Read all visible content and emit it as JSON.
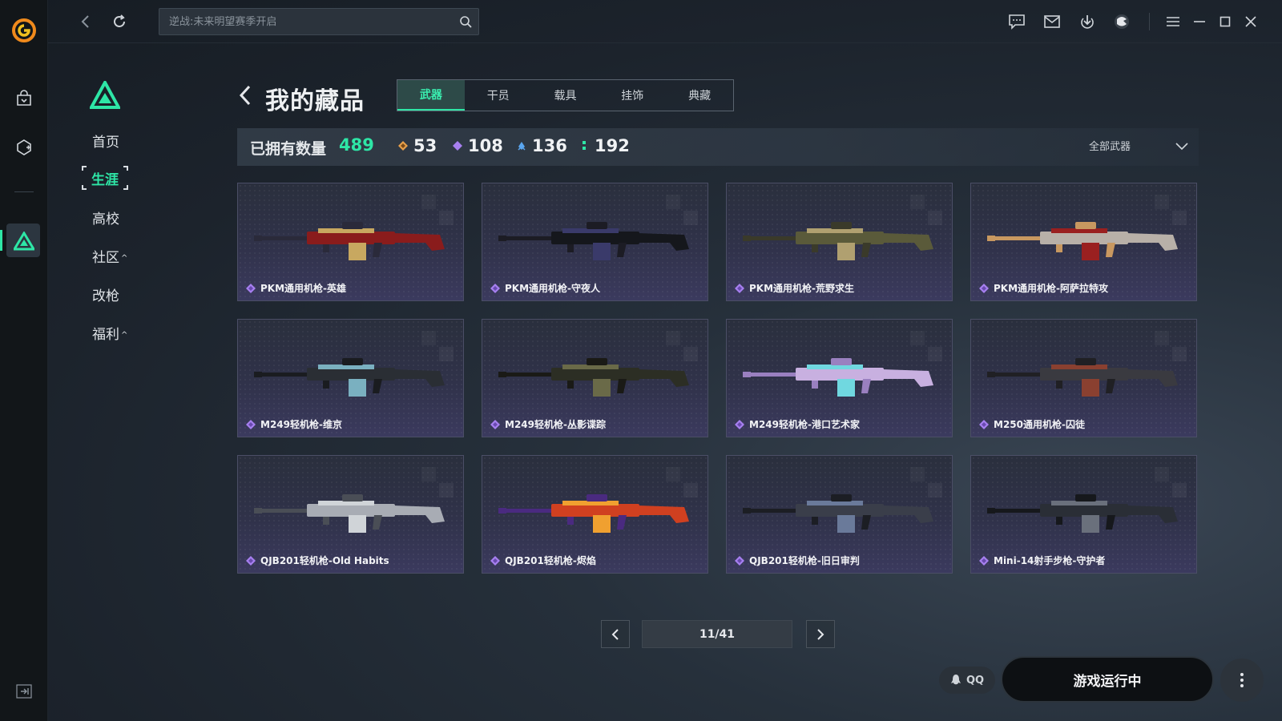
{
  "topbar": {
    "search_placeholder": "逆战:未来明望赛季开启"
  },
  "sidebar": {
    "items": [
      {
        "label": "首页"
      },
      {
        "label": "生涯"
      },
      {
        "label": "高校"
      },
      {
        "label": "社区",
        "caret": "^"
      },
      {
        "label": "改枪"
      },
      {
        "label": "福利",
        "caret": "^"
      }
    ]
  },
  "header": {
    "title": "我的藏品",
    "tabs": [
      {
        "label": "武器"
      },
      {
        "label": "干员"
      },
      {
        "label": "载具"
      },
      {
        "label": "挂饰"
      },
      {
        "label": "典藏"
      }
    ]
  },
  "stats": {
    "owned_label": "已拥有数量",
    "owned_total": "489",
    "tiers": [
      {
        "count": "53",
        "color": "#e8a04a"
      },
      {
        "count": "108",
        "color": "#a780f0"
      },
      {
        "count": "136",
        "color": "#5aa6f0"
      },
      {
        "count": "192",
        "color": "#2ee6a6"
      }
    ],
    "filter_label": "全部武器"
  },
  "cards": [
    {
      "name": "PKM通用机枪-英雄",
      "palette": [
        "#8a1c1c",
        "#c8a860",
        "#2a2a3a"
      ]
    },
    {
      "name": "PKM通用机枪-守夜人",
      "palette": [
        "#15171c",
        "#3a3a6a",
        "#1c1c24"
      ]
    },
    {
      "name": "PKM通用机枪-荒野求生",
      "palette": [
        "#5a5a3a",
        "#b0a070",
        "#3a3a2a"
      ]
    },
    {
      "name": "PKM通用机枪-阿萨拉特攻",
      "palette": [
        "#b8b0a8",
        "#9a2020",
        "#c89860"
      ]
    },
    {
      "name": "M249轻机枪-维京",
      "palette": [
        "#2a2e34",
        "#7ab0c0",
        "#1a1c20"
      ]
    },
    {
      "name": "M249轻机枪-丛影谍踪",
      "palette": [
        "#2c2e24",
        "#6a6a48",
        "#1a1a16"
      ]
    },
    {
      "name": "M249轻机枪-港口艺术家",
      "palette": [
        "#c8b0e0",
        "#70d8e0",
        "#9a80c0"
      ]
    },
    {
      "name": "M250通用机枪-囚徒",
      "palette": [
        "#3a3a40",
        "#8a4030",
        "#202024"
      ]
    },
    {
      "name": "QJB201轻机枪-Old Habits",
      "palette": [
        "#a8acb4",
        "#d0d4d8",
        "#4a4e56"
      ]
    },
    {
      "name": "QJB201轻机枪-烬焰",
      "palette": [
        "#d04020",
        "#f0a030",
        "#4a2a80"
      ]
    },
    {
      "name": "QJB201轻机枪-旧日审判",
      "palette": [
        "#3a3e4a",
        "#6a7a9a",
        "#1c1e24"
      ]
    },
    {
      "name": "Mini-14射手步枪-守护者",
      "palette": [
        "#2a2e36",
        "#6a707c",
        "#16181c"
      ]
    }
  ],
  "pagination": {
    "display": "11/41"
  },
  "actions": {
    "qq_label": "QQ",
    "play_label": "游戏运行中"
  },
  "colors": {
    "accent": "#2ee6a6",
    "rarity_purple": "#a780f0"
  }
}
